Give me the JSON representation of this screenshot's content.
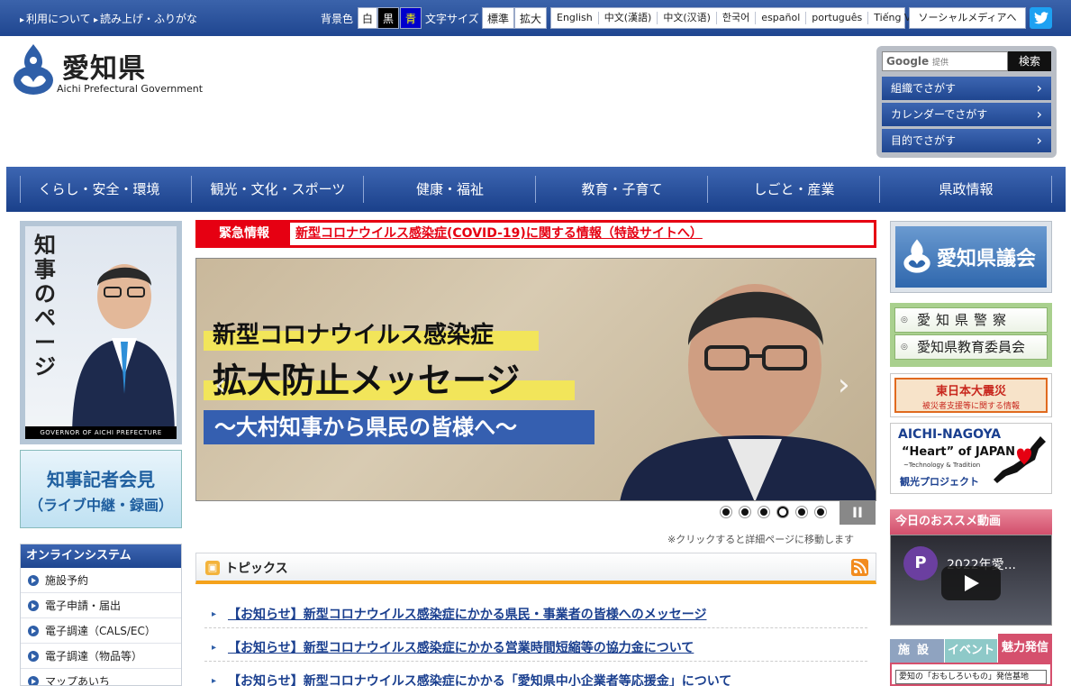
{
  "topbar": {
    "links": [
      "利用について",
      "読み上げ・ふりがな"
    ],
    "bg_label": "背景色",
    "bg_options": [
      {
        "label": "白",
        "bg": "#ffffff",
        "fg": "#222222"
      },
      {
        "label": "黒",
        "bg": "#000000",
        "fg": "#ffffff"
      },
      {
        "label": "青",
        "bg": "#0000cc",
        "fg": "#ffff00"
      }
    ],
    "font_label": "文字サイズ",
    "font_options": [
      "標準",
      "拡大"
    ],
    "languages": [
      "English",
      "中文(漢語)",
      "中文(汉语)",
      "한국어",
      "español",
      "português",
      "Tiếng Việt"
    ],
    "sns_label": "ソーシャルメディアへ",
    "twitter_icon": "twitter-icon"
  },
  "header": {
    "logo_jp": "愛知県",
    "logo_en": "Aichi Prefectural Government",
    "search": {
      "google": "Google",
      "provided": "提供",
      "button": "検索"
    },
    "find_buttons": [
      "組織でさがす",
      "カレンダーでさがす",
      "目的でさがす"
    ]
  },
  "gnav": [
    "くらし・安全・環境",
    "観光・文化・スポーツ",
    "健康・福祉",
    "教育・子育て",
    "しごと・産業",
    "県政情報"
  ],
  "left": {
    "governor_title": "知事のページ",
    "governor_caption": "GOVERNOR OF AICHI PREFECTURE",
    "press_line1": "知事記者会見",
    "press_line2": "（ライブ中継・録画）",
    "online_title": "オンラインシステム",
    "online_items": [
      "施設予約",
      "電子申請・届出",
      "電子調達（CALS/EC）",
      "電子調達（物品等）",
      "マップあいち"
    ]
  },
  "center": {
    "emergency_label": "緊急情報",
    "emergency_link": "新型コロナウイルス感染症(COVID-19)に関する情報（特設サイトへ）",
    "slide": {
      "line1": "新型コロナウイルス感染症",
      "line2": "拡大防止メッセージ",
      "line3": "～大村知事から県民の皆様へ～"
    },
    "slider_dots": 6,
    "slider_active": 3,
    "pause_label": "II",
    "click_note": "※クリックすると詳細ページに移動します",
    "topics_title": "トピックス",
    "topics": [
      "【お知らせ】新型コロナウイルス感染症にかかる県民・事業者の皆様へのメッセージ",
      "【お知らせ】新型コロナウイルス感染症にかかる営業時間短縮等の協力金について",
      "【お知らせ】新型コロナウイルス感染症にかかる「愛知県中小企業者等応援金」について"
    ]
  },
  "right": {
    "assembly": "愛知県議会",
    "police": [
      "愛知県警察",
      "愛知県教育委員会"
    ],
    "disaster_t1": "東日本大震災",
    "disaster_t2": "被災者支援等に関する情報",
    "heart_t1": "AICHI-NAGOYA",
    "heart_t2": "“Heart” of JAPAN",
    "heart_t3": "~Technology & Tradition",
    "heart_t4": "観光プロジェクト",
    "video_head": "今日のおススメ動画",
    "video_avatar": "P",
    "video_title": "2022年愛...",
    "tabs": [
      "施設",
      "イベント",
      "魅力発信"
    ],
    "tab_panel": "愛知の「おもしろいもの」発信基地"
  }
}
